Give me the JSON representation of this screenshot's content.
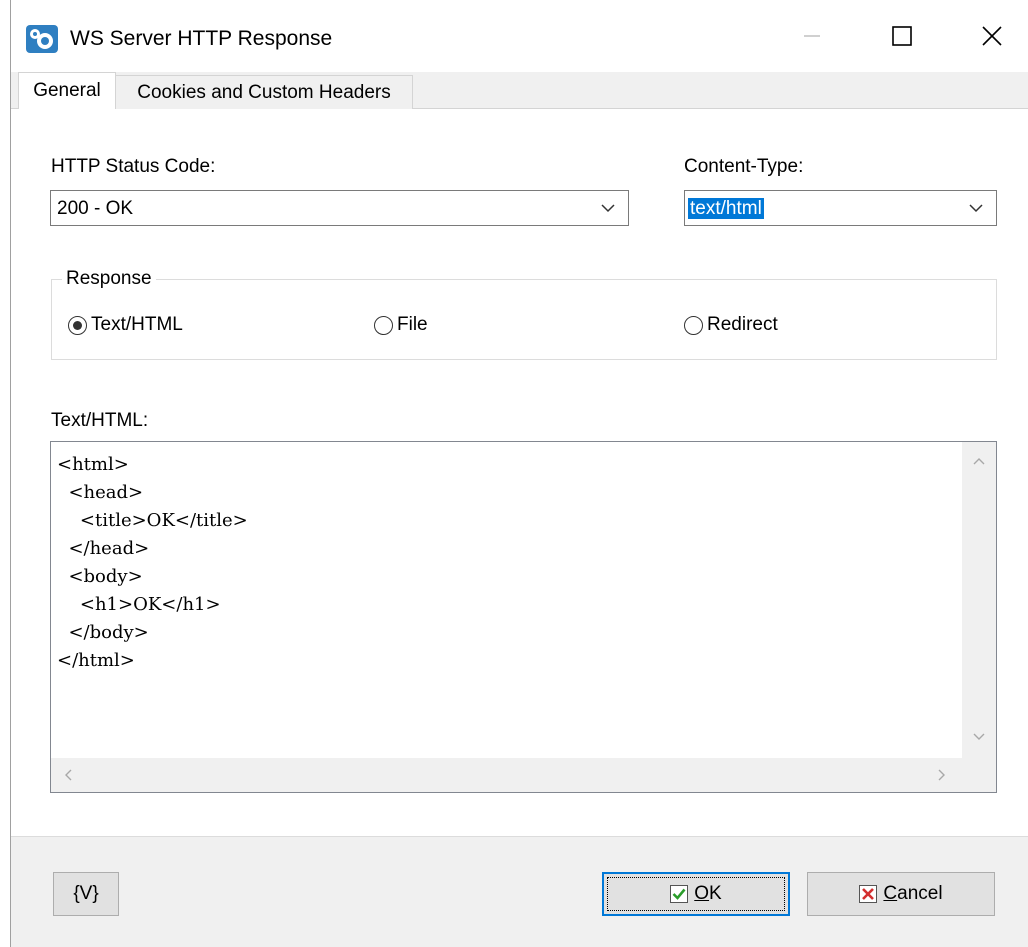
{
  "window": {
    "title": "WS Server HTTP Response",
    "icon": "gear-app-icon",
    "controls": [
      "minimize-icon",
      "maximize-icon",
      "close-icon"
    ]
  },
  "tabs": [
    {
      "label": "General",
      "active": true
    },
    {
      "label": "Cookies and Custom Headers",
      "active": false
    }
  ],
  "status_code": {
    "label": "HTTP Status Code:",
    "value": "200 - OK"
  },
  "content_type": {
    "label": "Content-Type:",
    "value": "text/html"
  },
  "response": {
    "group_label": "Response",
    "options": [
      {
        "label": "Text/HTML",
        "checked": true
      },
      {
        "label": "File",
        "checked": false
      },
      {
        "label": "Redirect",
        "checked": false
      }
    ]
  },
  "editor": {
    "label": "Text/HTML:",
    "lines": [
      "<html>",
      "  <head>",
      "    <title>OK</title>",
      "  </head>",
      "  <body>",
      "    <h1>OK</h1>",
      "  </body>",
      "</html>"
    ]
  },
  "buttons": {
    "variables": "{V}",
    "ok_prefix": "",
    "ok_accel": "O",
    "ok_rest": "K",
    "cancel_accel": "C",
    "cancel_rest": "ancel"
  },
  "colors": {
    "accent": "#0078d7",
    "ok_check": "#2a9d2a",
    "cancel_x": "#d32f2f"
  }
}
